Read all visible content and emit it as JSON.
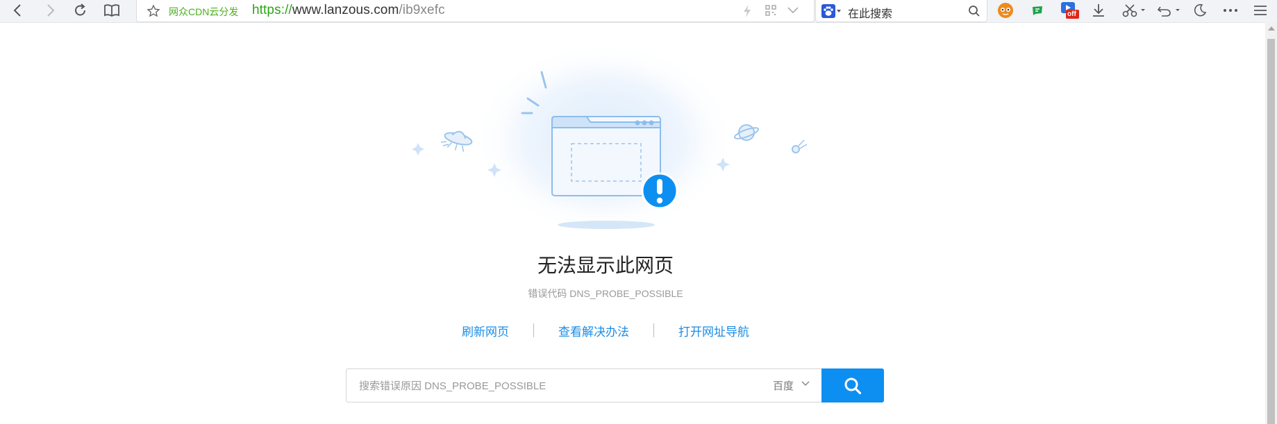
{
  "toolbar": {
    "address": {
      "cdn_label": "网众CDN云分发",
      "url_protocol": "https://",
      "url_host": "www.lanzous.com",
      "url_path": "/ib9xefc"
    },
    "search": {
      "placeholder": "在此搜索"
    },
    "ext_badge": "off"
  },
  "error": {
    "title": "无法显示此网页",
    "code_text": "错误代码 DNS_PROBE_POSSIBLE"
  },
  "actions": {
    "refresh": "刷新网页",
    "solutions": "查看解决办法",
    "open_nav": "打开网址导航"
  },
  "search_error": {
    "placeholder": "搜索错误原因 DNS_PROBE_POSSIBLE",
    "engine": "百度"
  },
  "colors": {
    "accent": "#0d8ff2",
    "link": "#1a8ce5",
    "cdn_green": "#4caf1e"
  }
}
